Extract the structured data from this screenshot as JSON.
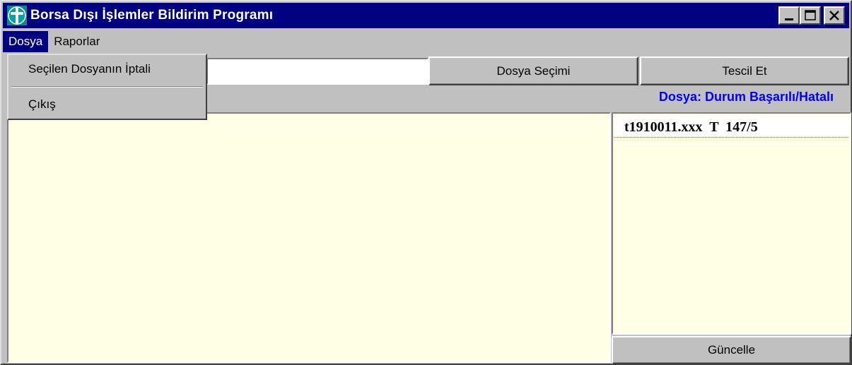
{
  "window": {
    "title": "Borsa Dışı İşlemler Bildirim Programı",
    "icon": "app-cross-icon"
  },
  "menubar": {
    "items": [
      {
        "label": "Dosya"
      },
      {
        "label": "Raporlar"
      }
    ]
  },
  "dropdown": {
    "items": [
      {
        "label": "Seçilen Dosyanın İptali"
      },
      {
        "label": "Çıkış"
      }
    ]
  },
  "toolbar": {
    "file_input_value": "",
    "select_file_label": "Dosya Seçimi",
    "register_label": "Tescil Et"
  },
  "status_label": "Dosya: Durum Başarılı/Hatalı",
  "file_list": {
    "rows": [
      {
        "text": "t1910011.xxx  T  147/5"
      }
    ]
  },
  "update_label": "Güncelle",
  "colors": {
    "title_bar": "#000080",
    "status_text": "#0000ff",
    "pane_background": "#ffffe6"
  }
}
